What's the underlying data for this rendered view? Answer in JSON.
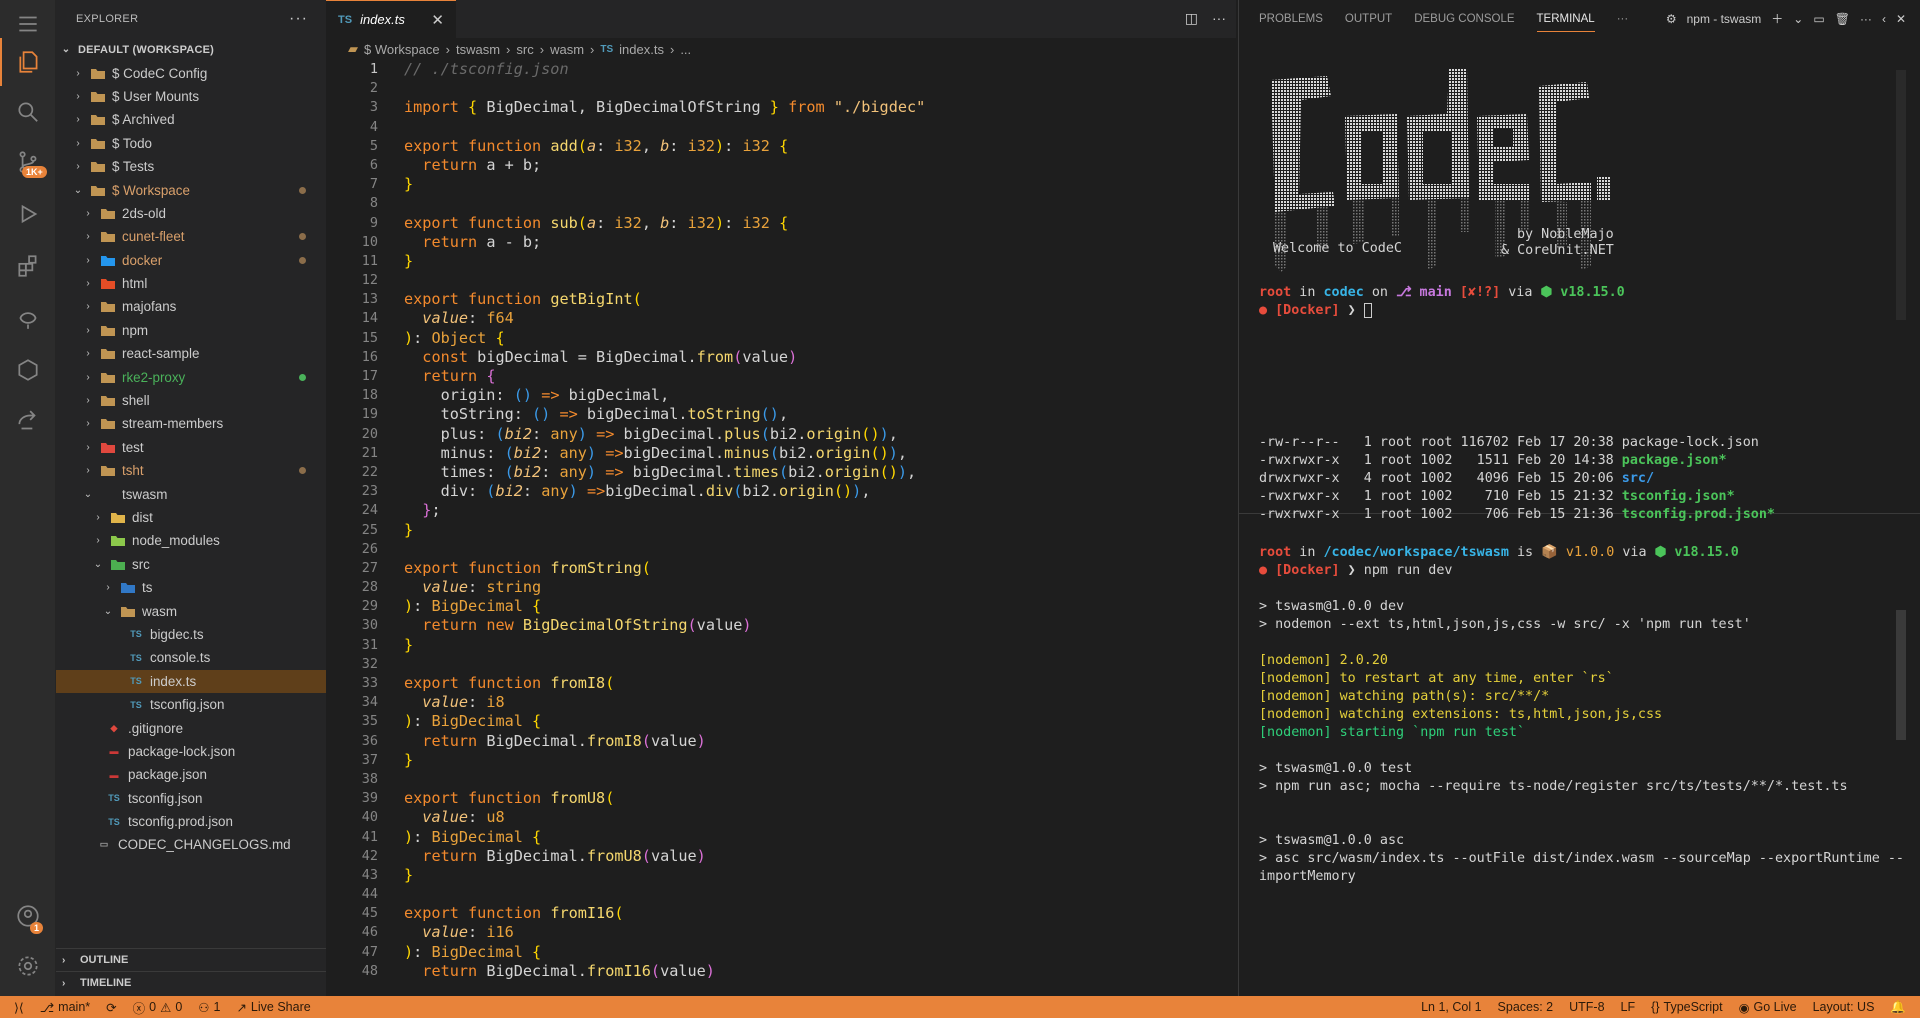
{
  "sidebar": {
    "title": "EXPLORER",
    "workspace_label": "DEFAULT (WORKSPACE)",
    "folders": [
      {
        "label": "$ CodeC Config"
      },
      {
        "label": "$ User Mounts"
      },
      {
        "label": "$ Archived"
      },
      {
        "label": "$ Todo"
      },
      {
        "label": "$ Tests"
      },
      {
        "label": "$ Workspace"
      }
    ],
    "workspace_items": [
      {
        "label": "2ds-old"
      },
      {
        "label": "cunet-fleet"
      },
      {
        "label": "docker"
      },
      {
        "label": "html"
      },
      {
        "label": "majofans"
      },
      {
        "label": "npm"
      },
      {
        "label": "react-sample"
      },
      {
        "label": "rke2-proxy"
      },
      {
        "label": "shell"
      },
      {
        "label": "stream-members"
      },
      {
        "label": "test"
      },
      {
        "label": "tsht"
      },
      {
        "label": "tswasm"
      }
    ],
    "tswasm_items": [
      {
        "label": "dist"
      },
      {
        "label": "node_modules"
      },
      {
        "label": "src"
      },
      {
        "label": "ts"
      },
      {
        "label": "wasm"
      },
      {
        "label": "bigdec.ts"
      },
      {
        "label": "console.ts"
      },
      {
        "label": "index.ts"
      },
      {
        "label": "tsconfig.json"
      },
      {
        "label": ".gitignore"
      },
      {
        "label": "package-lock.json"
      },
      {
        "label": "package.json"
      },
      {
        "label": "tsconfig.json"
      },
      {
        "label": "tsconfig.prod.json"
      },
      {
        "label": "CODEC_CHANGELOGS.md"
      }
    ],
    "outline_label": "OUTLINE",
    "timeline_label": "TIMELINE"
  },
  "activity": {
    "source_control_badge": "1K+",
    "accounts_badge": "1"
  },
  "editor": {
    "tab_label": "index.ts",
    "tab_lang": "TS",
    "breadcrumb": [
      "$ Workspace",
      "tswasm",
      "src",
      "wasm",
      "index.ts",
      "..."
    ]
  },
  "terminal": {
    "tabs": [
      "PROBLEMS",
      "OUTPUT",
      "DEBUG CONSOLE",
      "TERMINAL"
    ],
    "active_terminal": "npm - tswasm",
    "welcome": "Welcome to CodeC",
    "byline1": "by NobleMajo",
    "byline2": "& CoreUnit.NET"
  },
  "status_bar": {
    "branch": "main*",
    "errors": "0",
    "warnings": "0",
    "ports": "1",
    "live_share": "Live Share",
    "position": "Ln 1, Col 1",
    "spaces": "Spaces: 2",
    "encoding": "UTF-8",
    "eol": "LF",
    "language": "TypeScript",
    "go_live": "Go Live",
    "layout": "Layout: US"
  },
  "colors": {
    "accent": "#e8833a",
    "keyword": "#f38a2d",
    "function": "#f5d76e"
  }
}
